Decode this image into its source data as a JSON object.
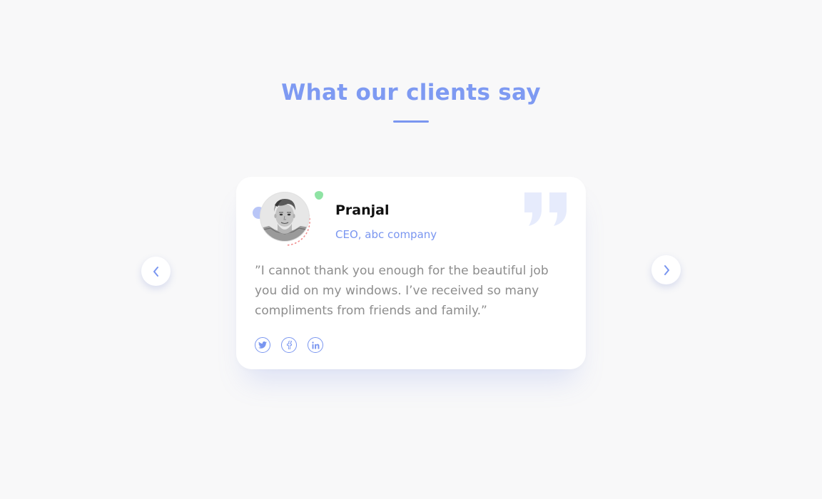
{
  "section": {
    "title": "What our clients say"
  },
  "testimonial": {
    "name": "Pranjal",
    "role": "CEO, abc company",
    "quote": "”I cannot thank you enough for the beautiful job you did on my windows. I’ve received so many compliments from friends and family.”"
  },
  "social": [
    "twitter-icon",
    "facebook-icon",
    "linkedin-icon"
  ],
  "colors": {
    "accent": "#7a96f0",
    "title": "#7e9af2",
    "quote_mark": "#e6ebfc",
    "dot_blue": "#b9c6f7",
    "dot_green": "#8fe3a4",
    "dotted_arc": "#f08a8a",
    "body_text": "#8d8d8d",
    "background": "#f8f8f9"
  },
  "icons": {
    "prev": "chevron-left-icon",
    "next": "chevron-right-icon",
    "quote": "quote-icon"
  }
}
